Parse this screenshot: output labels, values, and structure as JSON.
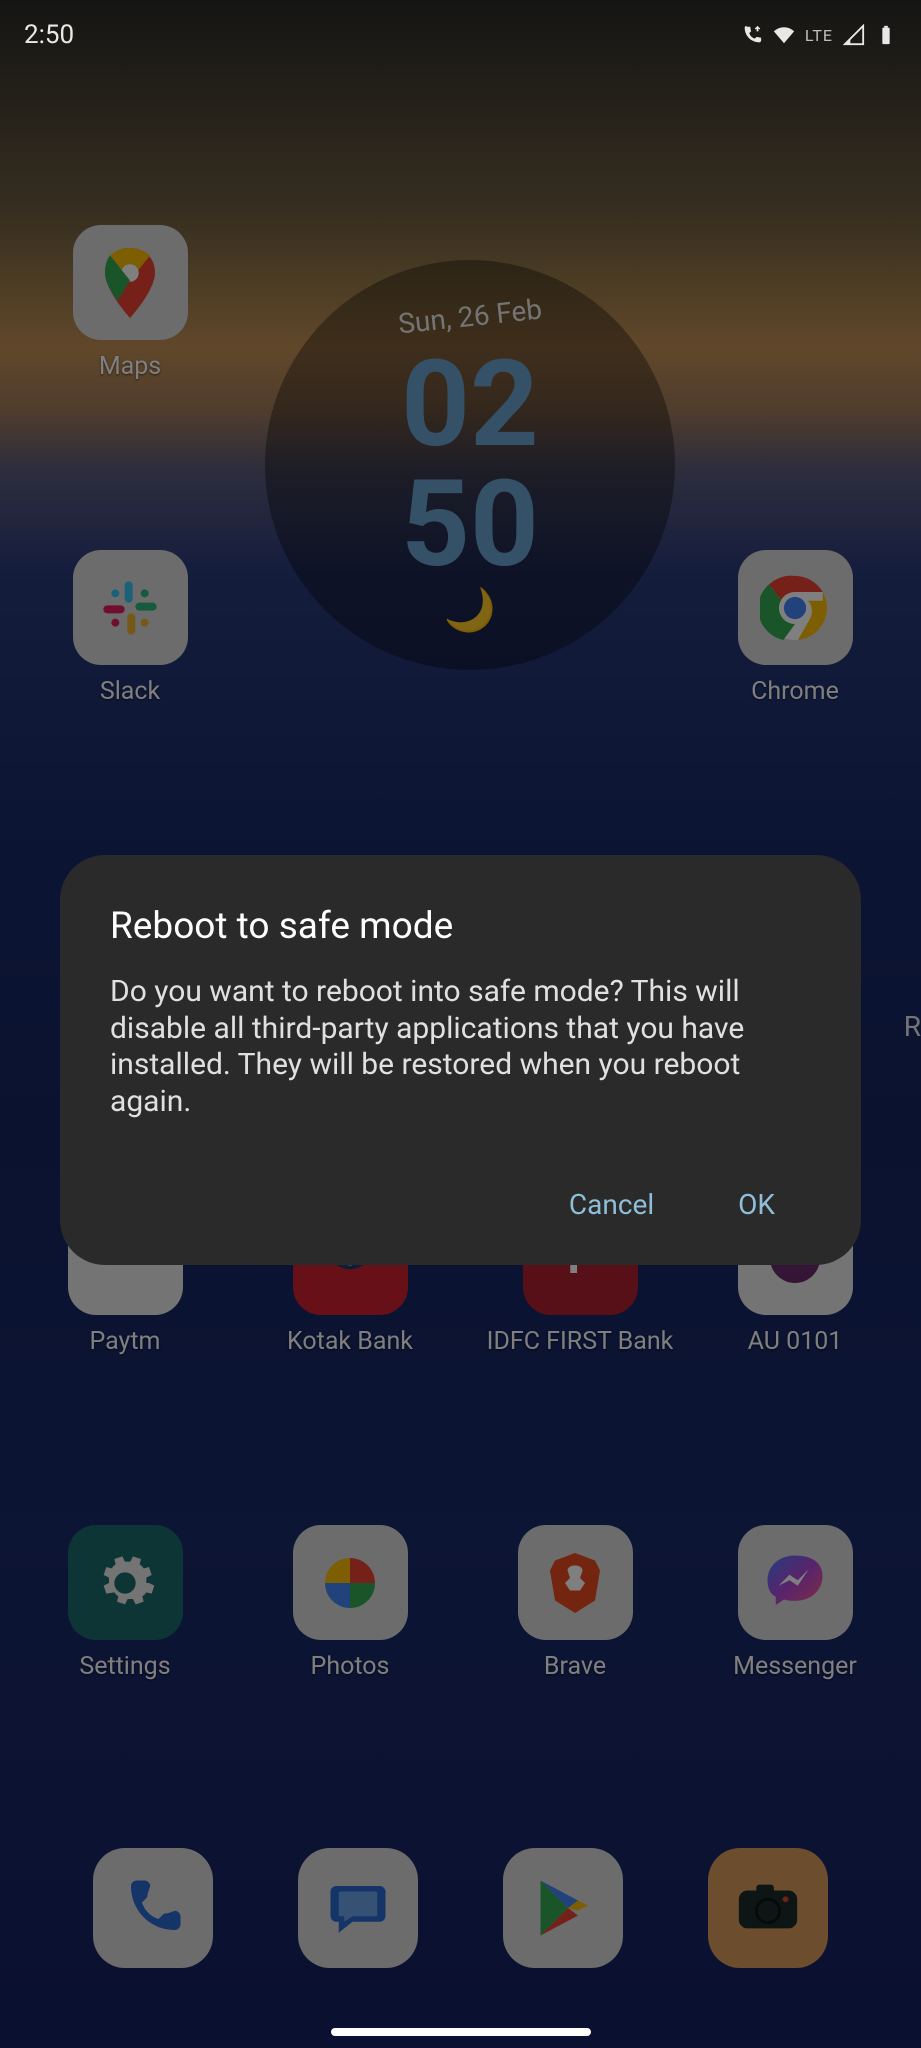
{
  "status": {
    "time": "2:50",
    "network_label": "LTE"
  },
  "clock": {
    "date": "Sun, 26 Feb",
    "hh": "02",
    "mm": "50"
  },
  "apps": {
    "maps": "Maps",
    "slack": "Slack",
    "chrome": "Chrome",
    "paytm": "Paytm",
    "kotak": "Kotak Bank",
    "idfc": "IDFC FIRST Bank",
    "au": "AU 0101",
    "settings": "Settings",
    "photos": "Photos",
    "brave": "Brave",
    "messenger": "Messenger"
  },
  "dialog": {
    "title": "Reboot to safe mode",
    "body": "Do you want to reboot into safe mode? This will disable all third-party applications that you have installed. They will be restored when you reboot again.",
    "cancel": "Cancel",
    "ok": "OK"
  },
  "peek": "R"
}
